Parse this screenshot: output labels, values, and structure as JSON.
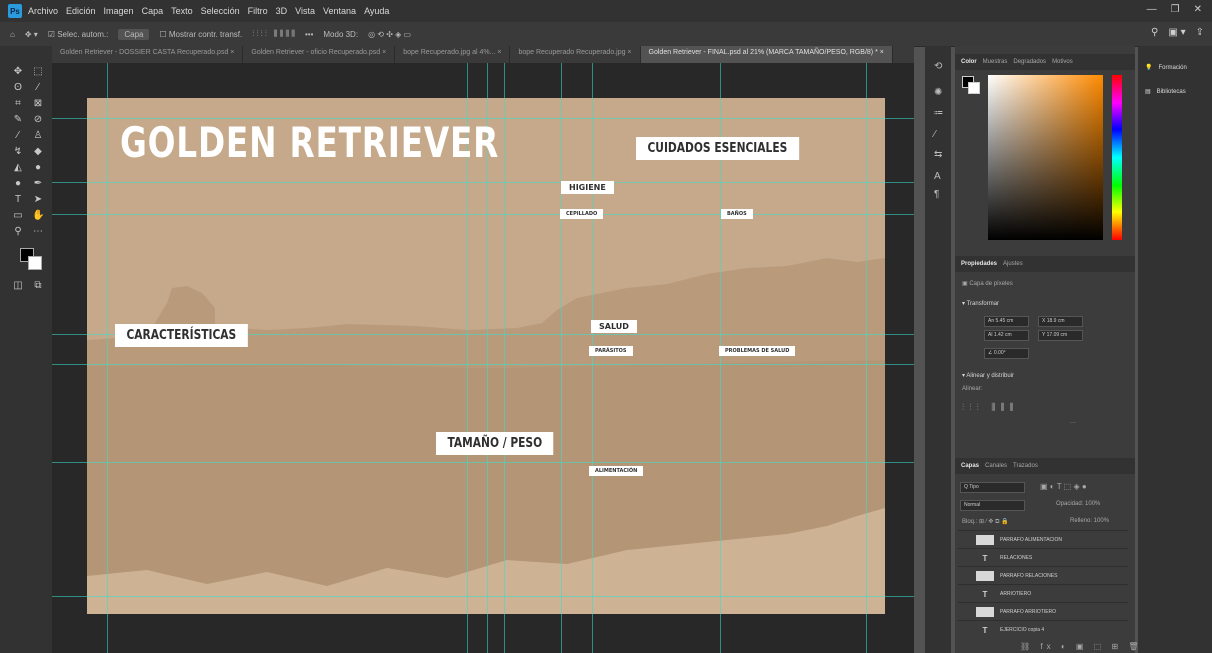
{
  "app": {
    "logo": "Ps",
    "menu": [
      "Archivo",
      "Edición",
      "Imagen",
      "Capa",
      "Texto",
      "Selección",
      "Filtro",
      "3D",
      "Vista",
      "Ventana",
      "Ayuda"
    ],
    "window_controls": [
      "—",
      "❐",
      "✕"
    ]
  },
  "options_bar": {
    "auto_select_label": "Selec. autom.:",
    "auto_select_value": "Capa",
    "show_transform": "Mostrar contr. transf.",
    "more": "•••",
    "mode_3d": "Modo 3D:"
  },
  "tabs": [
    {
      "label": "Golden Retriever - DOSSIER CASTA Recuperado.psd ×",
      "active": false
    },
    {
      "label": "Golden Retriever - oficio Recuperado.psd ×",
      "active": false
    },
    {
      "label": "bope Recuperado.jpg al 4%... ×",
      "active": false
    },
    {
      "label": "bope Recuperado Recuperado.jpg ×",
      "active": false
    },
    {
      "label": "Golden Retriever - FINAL.psd al 21% (MARCA TAMAÑO/PESO, RGB/8) * ×",
      "active": true
    }
  ],
  "artboard": {
    "title": "GOLDEN RETRIEVER",
    "tags": {
      "cuidados": "CUIDADOS ESENCIALES",
      "higiene": "HIGIENE",
      "cepillado": "CEPILLADO",
      "banos": "BAÑOS",
      "caracteristicas": "CARACTERÍSTICAS",
      "salud": "SALUD",
      "parasitos": "PARÁSITOS",
      "problemas": "PROBLEMAS DE SALUD",
      "tamano": "TAMAÑO / PESO",
      "alimentacion": "ALIMENTACIÓN"
    },
    "colors": {
      "paper": "#c5a98a",
      "mid": "#b89a7b",
      "dark": "#ad8e70",
      "light": "#d1b799"
    }
  },
  "color_panel": {
    "tabs": [
      "Color",
      "Muestras",
      "Degradados",
      "Motivos"
    ],
    "hue_color": "#ff8a00"
  },
  "properties_panel": {
    "tabs": [
      "Propiedades",
      "Ajustes"
    ],
    "layer_type": "Capa de píxeles",
    "transform_title": "Transformar",
    "w": "An 5.45 cm",
    "x": "X 18.9 cm",
    "h": "Al 1.42 cm",
    "y": "Y 17.09 cm",
    "angle": "∠ 0.00°",
    "align_title": "Alinear y distribuir",
    "align_sub": "Alinear:"
  },
  "layers_panel": {
    "tabs": [
      "Capas",
      "Canales",
      "Trazados"
    ],
    "kind": "Q Tipo",
    "blend": "Normal",
    "opacity": "Opacidad: 100%",
    "lock": "Bloq.:",
    "fill": "Relleno: 100%",
    "layers": [
      {
        "name": "PARRAFO ALIMENTACION",
        "type": "pixel"
      },
      {
        "name": "RELACIONES",
        "type": "text"
      },
      {
        "name": "PARRAFO RELACIONES",
        "type": "pixel"
      },
      {
        "name": "ARRIOTIERO",
        "type": "text"
      },
      {
        "name": "PARRAFO ARRIOTIERO",
        "type": "pixel"
      },
      {
        "name": "EJERCICIO copia 4",
        "type": "text"
      }
    ]
  },
  "far_right": {
    "learn": "Formación",
    "libraries": "Bibliotecas"
  }
}
